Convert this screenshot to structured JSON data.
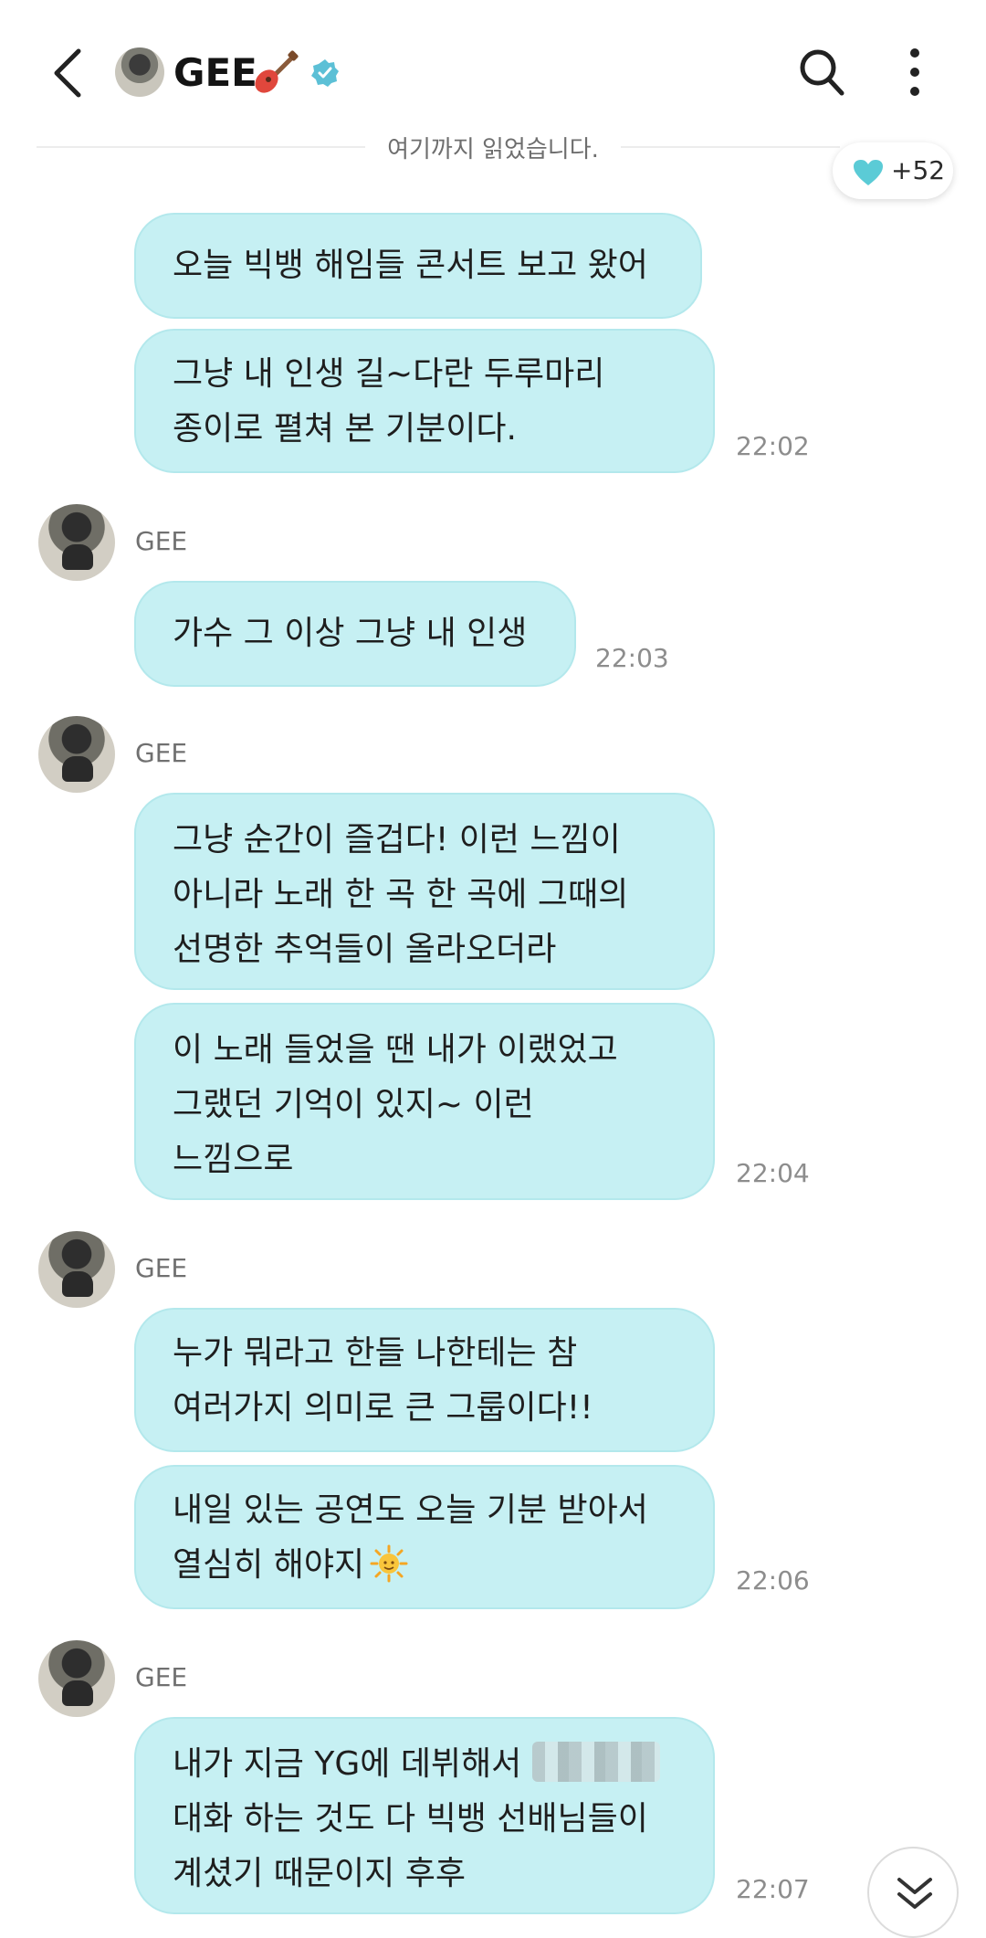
{
  "header": {
    "title": "GEE",
    "title_emoji_icon": "guitar-icon",
    "verified_icon": "verified-badge-icon",
    "accent": "#4fc1d0"
  },
  "read_marker": "여기까지 읽었습니다.",
  "likes": {
    "count": "+52",
    "icon": "heart-icon",
    "color": "#5bcbd6"
  },
  "messages": [
    {
      "text": "오늘 빅뱅 해임들 콘서트 보고 왔어"
    },
    {
      "text": "그냥 내 인생 길~다란 두루마리\n종이로 펼쳐 본 기분이다.",
      "time": "22:02"
    },
    {
      "sender": "GEE",
      "text": "가수 그 이상 그냥 내 인생",
      "time": "22:03"
    },
    {
      "sender": "GEE",
      "text": "그냥 순간이 즐겁다! 이런 느낌이\n아니라 노래 한 곡 한 곡에 그때의\n선명한 추억들이 올라오더라"
    },
    {
      "text": "이 노래 들었을 땐 내가 이랬었고\n그랬던 기억이 있지~ 이런\n느낌으로",
      "time": "22:04"
    },
    {
      "sender": "GEE",
      "text": "누가 뭐라고 한들 나한테는 참\n여러가지 의미로 큰 그룹이다!!"
    },
    {
      "text": "내일 있는 공연도 오늘 기분 받아서\n열심히 해야지",
      "time": "22:06"
    },
    {
      "sender": "GEE",
      "text_line1": "내가 지금 YG에 데뷔해서",
      "text_rest": "대화 하는 것도 다 빅뱅 선배님들이\n계셨기 때문이지 후후",
      "time": "22:07"
    }
  ],
  "bubble_color": "#c6f0f3",
  "scroll_button_icon": "double-chevron-down-icon"
}
